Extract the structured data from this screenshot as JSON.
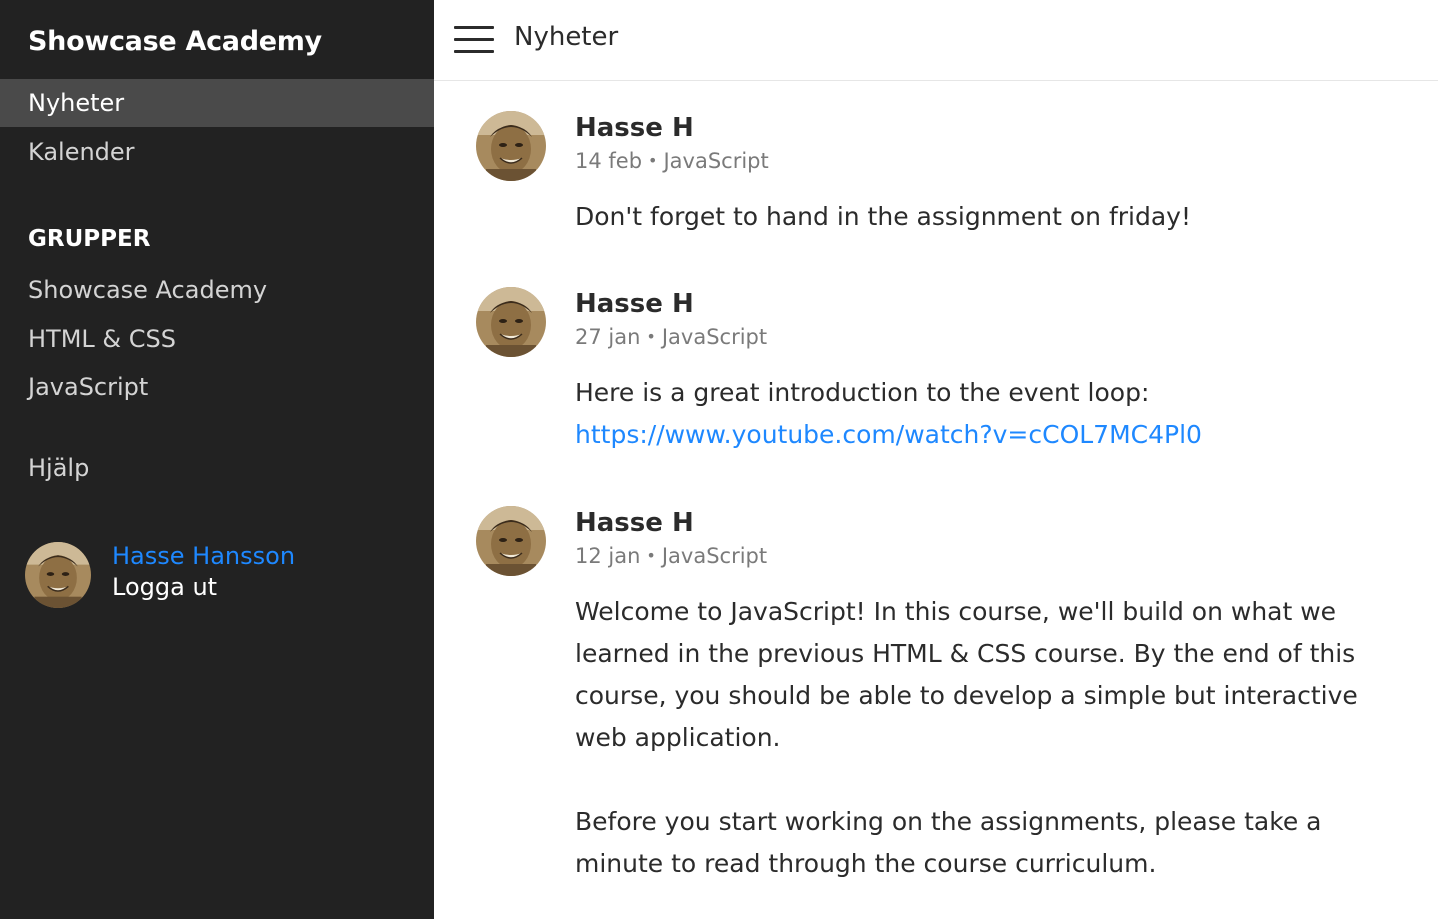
{
  "sidebar": {
    "brand": "Showcase Academy",
    "nav": [
      {
        "label": "Nyheter",
        "active": true
      },
      {
        "label": "Kalender",
        "active": false
      }
    ],
    "groups_title": "GRUPPER",
    "groups": [
      "Showcase Academy",
      "HTML & CSS",
      "JavaScript"
    ],
    "help": "Hjälp",
    "user": {
      "name": "Hasse Hansson",
      "logout": "Logga ut"
    }
  },
  "topbar": {
    "menu_icon": "hamburger-menu-icon",
    "title": "Nyheter"
  },
  "posts": [
    {
      "author": "Hasse H",
      "date": "14 feb",
      "separator": "•",
      "group": "JavaScript",
      "paragraphs": [
        "Don't forget to hand in the assignment on friday!"
      ]
    },
    {
      "author": "Hasse H",
      "date": "27 jan",
      "separator": "•",
      "group": "JavaScript",
      "text": "Here is a great introduction to the event loop:",
      "link": "https://www.youtube.com/watch?v=cCOL7MC4Pl0"
    },
    {
      "author": "Hasse H",
      "date": "12 jan",
      "separator": "•",
      "group": "JavaScript",
      "paragraphs": [
        "Welcome to JavaScript! In this course, we'll build on what we learned in the previous HTML & CSS course. By the end of this course, you should be able to develop a simple but interactive web application.",
        "Before you start working on the assignments, please take a minute to read through the course curriculum."
      ]
    }
  ],
  "colors": {
    "sidebar_bg": "#222222",
    "active_item_bg": "#4a4a4a",
    "link": "#1e88ff",
    "text": "#2b2b2b",
    "meta": "#7a7a7a"
  }
}
